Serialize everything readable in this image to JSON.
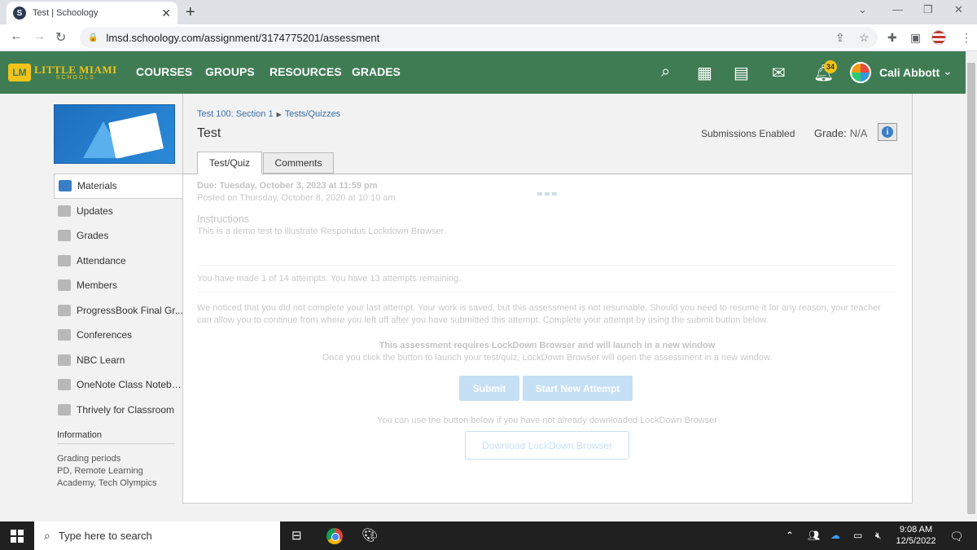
{
  "browser": {
    "tab_title": "Test | Schoology",
    "tab_favicon": "S",
    "url": "lmsd.schoology.com/assignment/3174775201/assessment"
  },
  "header": {
    "logo_text": "LITTLE MIAMI",
    "logo_sub": "SCHOOLS",
    "logo_mark": "LM",
    "nav": [
      "COURSES",
      "GROUPS",
      "RESOURCES",
      "GRADES"
    ],
    "notification_count": "34",
    "user_name": "Cali Abbott",
    "accent_color": "#3f7c53",
    "logo_color": "#f0c419"
  },
  "sidebar": {
    "items": [
      {
        "label": "Materials",
        "icon": "materials-icon"
      },
      {
        "label": "Updates",
        "icon": "updates-icon"
      },
      {
        "label": "Grades",
        "icon": "grades-icon"
      },
      {
        "label": "Attendance",
        "icon": "attendance-icon"
      },
      {
        "label": "Members",
        "icon": "members-icon"
      },
      {
        "label": "ProgressBook Final Gr...",
        "icon": "progressbook-icon"
      },
      {
        "label": "Conferences",
        "icon": "conferences-icon"
      },
      {
        "label": "NBC Learn",
        "icon": "nbc-learn-icon"
      },
      {
        "label": "OneNote Class Notebo...",
        "icon": "onenote-icon"
      },
      {
        "label": "Thrively for Classroom",
        "icon": "thrively-icon"
      }
    ],
    "info_heading": "Information",
    "info_label": "Grading periods",
    "info_value": "PD, Remote Learning Academy, Tech Olympics"
  },
  "main": {
    "breadcrumb": [
      "Test 100: Section 1",
      "Tests/Quizzes"
    ],
    "title": "Test",
    "submissions_status": "Submissions Enabled",
    "grade_label": "Grade:",
    "grade_value": "N/A",
    "tabs": [
      "Test/Quiz",
      "Comments"
    ],
    "due": "Due: Tuesday, October 3, 2023 at 11:59 pm",
    "posted": "Posted on Thursday, October 8, 2020 at 10:10 am",
    "instructions_heading": "Instructions",
    "instructions_body": "This is a demo test to illustrate Respondus Lockdown Browser.",
    "attempts": "You have made 1 of 14 attempts. You have 13 attempts remaining.",
    "notice": "We noticed that you did not complete your last attempt. Your work is saved, but this assessment is not resumable. Should you need to resume it for any reason, your teacher can allow you to continue from where you left off after you have submitted this attempt. Complete your attempt by using the submit button below.",
    "lockdown_heading": "This assessment requires LockDown Browser and will launch in a new window",
    "lockdown_body": "Once you click the button to launch your test/quiz, LockDown Browser will open the assessment in a new window.",
    "submit_label": "Submit",
    "new_attempt_label": "Start New Attempt",
    "download_hint": "You can use the button below if you have not already downloaded LockDown Browser",
    "download_label": "Download LockDown Browser"
  },
  "taskbar": {
    "search_placeholder": "Type here to search",
    "time": "9:08 AM",
    "date": "12/5/2022"
  }
}
